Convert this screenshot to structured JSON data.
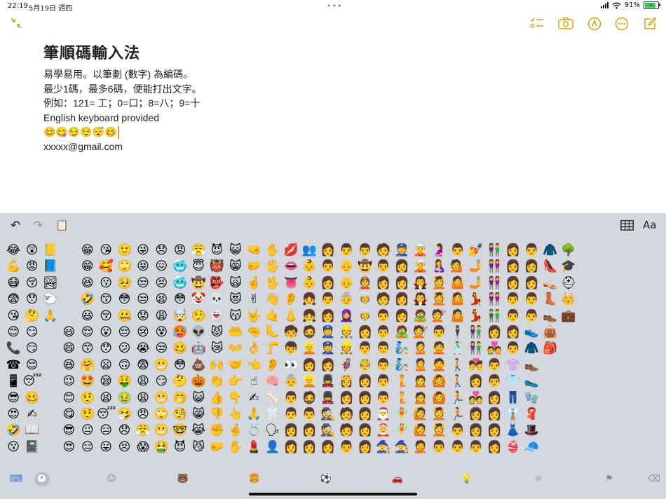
{
  "status_bar": {
    "time": "22:19",
    "date": "5月19日 週四",
    "battery": "91%",
    "more_dots": "•••"
  },
  "top_toolbar": {
    "collapse_icon": "collapse-arrows",
    "checklist_icon": "checklist",
    "camera_icon": "camera",
    "markup_icon": "pen-circle",
    "more_icon": "ellipsis-circle",
    "compose_icon": "compose"
  },
  "note": {
    "title": "筆順碼輸入法",
    "lines": [
      "易學易用。以筆劃 (數字) 為編碼。",
      "最少1碼，最多6碼，便能打出文字。",
      "例如：121= 工；0=口；8=八；9=十",
      "English keyboard provided",
      "😊😋😏😌😴🥴",
      "xxxxx@gmail.com"
    ]
  },
  "keyboard_toolbar": {
    "undo": "↶",
    "redo": "↷",
    "paste": "📋",
    "table_icon": "table",
    "format_label": "Aa"
  },
  "emoji_rows": [
    "😂😲📒_😁😘🙂😜😞😡😤😈😺🤜✋💋👥👩👨👨🧑👮🧝🤰👨💅👫👩👨🧥🌳",
    "💪😡📘_😁🥰🙄😝😖🥶😇👹😸🤛🖐👄👶👨👴🤠👨👩🧝🤱💁🤳👭👩👩👠🎓",
    "😷😚🏞_😆😗🥺😒😣🥶🤠👺🙀🤞🖖👅👶👩👴👲👩👩🧛💆🤷🤳👭👩👩👡⛑",
    "😨😯🐑_🤣😙😳😒😫😳🤡💀😻✌👋👂👧👨👵👳🧑👩🧛💆🤷💃👭👨👨👢👑",
    "😘🤔🙏_😃😚🤐😟😩🤯🤥👻😽🤟🤙👃👧👩🧕👳👨👩🧟💇🤷💃👬👨👨👞💼",
    "😊😏_😃😌😮😔😢😵🥵👽😾🤲🤏🦶🧒🧔👮👷👩👨🧟💇👨🕴👫👩👩👟👜",
    "📞😏_😄😙😯😕😭😒🥴🤖😿👐👌🦵👦👱👮👷👨👨🧞🙎🙅🕺👫💑👨🧥🎒",
    "☎😌_😆🤗😦🙃😨😬😳💩🙌🤝👈👂👀👩👩🦸🤴👨🧞🙎🙅🚶💏👨👚👞",
    "📱😴_😉🤩😪🤑😩😏🤔🎃👏👉☝🧠👵👱💂👸👩👨🧜🙍🙆🚶👩👨👕🥿",
    "😎🥴_😊🤨😫🤢😩😬🤭😺👍👇✍🦴👨🧔💂👩👩👨🧜🙍🙆🏃💑👩👖🧤",
    "😍✍_😋🤨😴🤧😠🙄🧐😸👎👆🙏🦷👨👨🕵🧑👩🎅🧚🙋💆🏃👩👩👔🧣",
    "🤣📖_😎😐😑😞😤😬🤓😹✊🤞💍🗣👩👩🕵🧑👩🤶🧚🙋💆👨👩👩👗🎩",
    "😗📓_😍😑😛😣😱🤮😈😼🤛✋💄👤👩👩👩👨👩🧙🧙🤦👨👨👨👩👙🧢"
  ],
  "categories": [
    {
      "name": "keyboard-icon",
      "glyph": "⌨"
    },
    {
      "name": "recent-icon",
      "glyph": "🕐"
    },
    {
      "name": "smileys-icon",
      "glyph": "☺"
    },
    {
      "name": "animals-icon",
      "glyph": "🐻"
    },
    {
      "name": "food-icon",
      "glyph": "🍔"
    },
    {
      "name": "activity-icon",
      "glyph": "⚽"
    },
    {
      "name": "travel-icon",
      "glyph": "🚗"
    },
    {
      "name": "objects-icon",
      "glyph": "💡"
    },
    {
      "name": "symbols-icon",
      "glyph": "⚛"
    },
    {
      "name": "flags-icon",
      "glyph": "⚑"
    },
    {
      "name": "delete-icon",
      "glyph": "⌫"
    }
  ],
  "colors": {
    "accent": "#d4a017",
    "keyboard_bg": "#d4d7de",
    "keyboard_switch": "#2c6fd6"
  }
}
